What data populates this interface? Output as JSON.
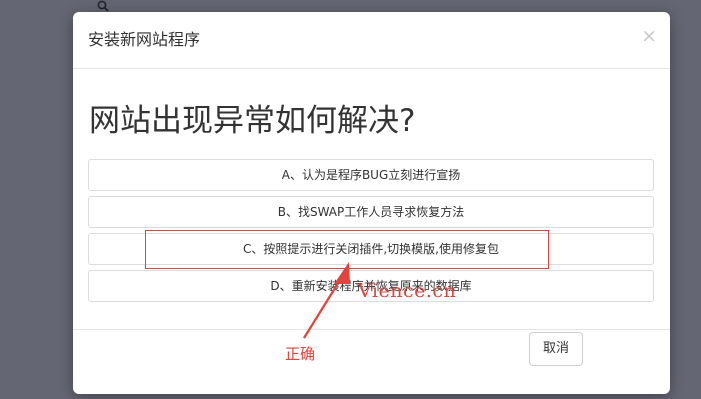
{
  "dialog": {
    "title": "安装新网站程序",
    "close_label": "×",
    "question": "网站出现异常如何解决?",
    "options": [
      {
        "label": "A、认为是程序BUG立刻进行宣扬"
      },
      {
        "label": "B、找SWAP工作人员寻求恢复方法"
      },
      {
        "label": "C、按照提示进行关闭插件,切换模版,使用修复包"
      },
      {
        "label": "D、重新安装程序并恢复原来的数据库"
      }
    ],
    "cancel_label": "取消"
  },
  "annotation": {
    "correct_label": "正确",
    "watermark": "Vience.cn",
    "color": "#e0443d"
  },
  "icons": {
    "background_search": "search-icon",
    "close": "close-icon"
  }
}
